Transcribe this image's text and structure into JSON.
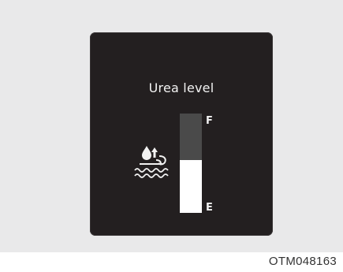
{
  "display": {
    "title": "Urea level",
    "full_label": "F",
    "empty_label": "E",
    "level_fraction": 0.53,
    "icon": "urea-icon"
  },
  "figure_code": "OTM048163",
  "colors": {
    "panel_background": "#e9e9ea",
    "display_background": "#231f20",
    "gauge_empty": "#4a4a4a",
    "gauge_fill": "#ffffff",
    "text": "#f2f2f2"
  }
}
